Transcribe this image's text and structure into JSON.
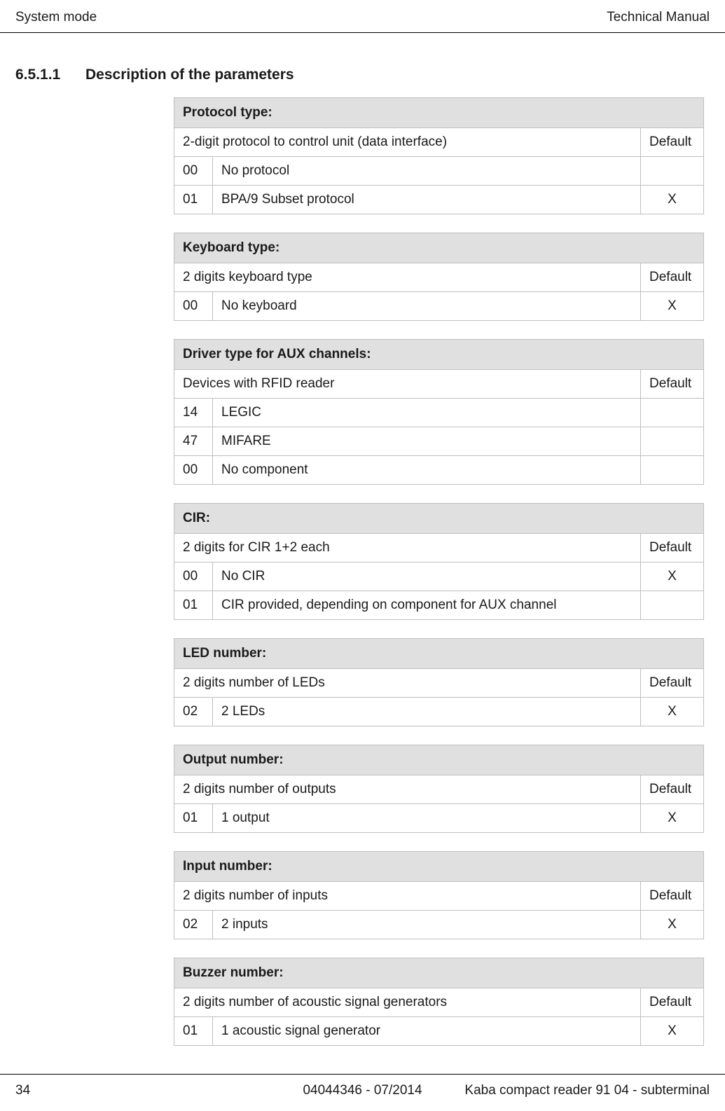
{
  "header": {
    "left": "System mode",
    "right": "Technical Manual"
  },
  "section": {
    "number": "6.5.1.1",
    "title": "Description of the parameters"
  },
  "tables": [
    {
      "title": "Protocol type:",
      "subhead": "2-digit protocol to control unit (data interface)",
      "default_label": "Default",
      "rows": [
        {
          "code": "00",
          "label": "No protocol",
          "default": ""
        },
        {
          "code": "01",
          "label": "BPA/9 Subset protocol",
          "default": "X"
        }
      ]
    },
    {
      "title": "Keyboard type:",
      "subhead": "2 digits keyboard type",
      "default_label": "Default",
      "rows": [
        {
          "code": "00",
          "label": "No keyboard",
          "default": "X"
        }
      ]
    },
    {
      "title": "Driver type for AUX channels:",
      "subhead": "Devices with RFID reader",
      "default_label": "Default",
      "rows": [
        {
          "code": "14",
          "label": "LEGIC",
          "default": ""
        },
        {
          "code": "47",
          "label": "MIFARE",
          "default": ""
        },
        {
          "code": "00",
          "label": "No component",
          "default": ""
        }
      ]
    },
    {
      "title": "CIR:",
      "subhead": "2 digits for CIR 1+2 each",
      "default_label": "Default",
      "rows": [
        {
          "code": "00",
          "label": "No CIR",
          "default": "X"
        },
        {
          "code": "01",
          "label": "CIR provided, depending on component for AUX channel",
          "default": ""
        }
      ]
    },
    {
      "title": "LED number:",
      "subhead": "2 digits number of LEDs",
      "default_label": "Default",
      "rows": [
        {
          "code": "02",
          "label": "2 LEDs",
          "default": "X"
        }
      ]
    },
    {
      "title": "Output number:",
      "subhead": "2 digits number of outputs",
      "default_label": "Default",
      "rows": [
        {
          "code": "01",
          "label": "1 output",
          "default": "X"
        }
      ]
    },
    {
      "title": "Input number:",
      "subhead": "2 digits number of inputs",
      "default_label": "Default",
      "rows": [
        {
          "code": "02",
          "label": "2 inputs",
          "default": "X"
        }
      ]
    },
    {
      "title": "Buzzer number:",
      "subhead": "2 digits number of acoustic signal generators",
      "default_label": "Default",
      "rows": [
        {
          "code": "01",
          "label": "1 acoustic signal generator",
          "default": "X"
        }
      ]
    }
  ],
  "footer": {
    "page": "34",
    "center": "04044346 - 07/2014",
    "right": "Kaba compact reader 91 04 - subterminal"
  }
}
